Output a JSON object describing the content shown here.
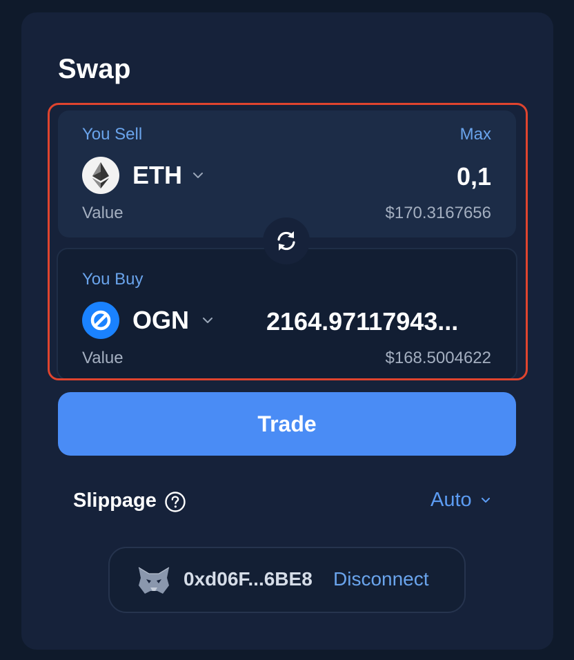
{
  "swap": {
    "title": "Swap",
    "sell": {
      "label": "You Sell",
      "max_label": "Max",
      "token_symbol": "ETH",
      "token_icon": "ethereum-icon",
      "amount": "0,1",
      "value_label": "Value",
      "value_amount": "$170.3167656"
    },
    "buy": {
      "label": "You Buy",
      "token_symbol": "OGN",
      "token_icon": "origin-protocol-icon",
      "amount": "2164.97117943...",
      "value_label": "Value",
      "value_amount": "$168.5004622"
    },
    "swap_direction_icon": "refresh-arrows-icon",
    "trade_label": "Trade",
    "slippage": {
      "label": "Slippage",
      "value": "Auto"
    },
    "wallet": {
      "icon": "metamask-fox-icon",
      "address": "0xd06F...6BE8",
      "disconnect_label": "Disconnect"
    }
  },
  "colors": {
    "background": "#0f1a2b",
    "panel": "#16223a",
    "sell_card": "#1c2c47",
    "accent": "#4a8cf5",
    "link": "#6aa4ec",
    "highlight_border": "#e0442e",
    "muted_text": "#a4afc0"
  }
}
